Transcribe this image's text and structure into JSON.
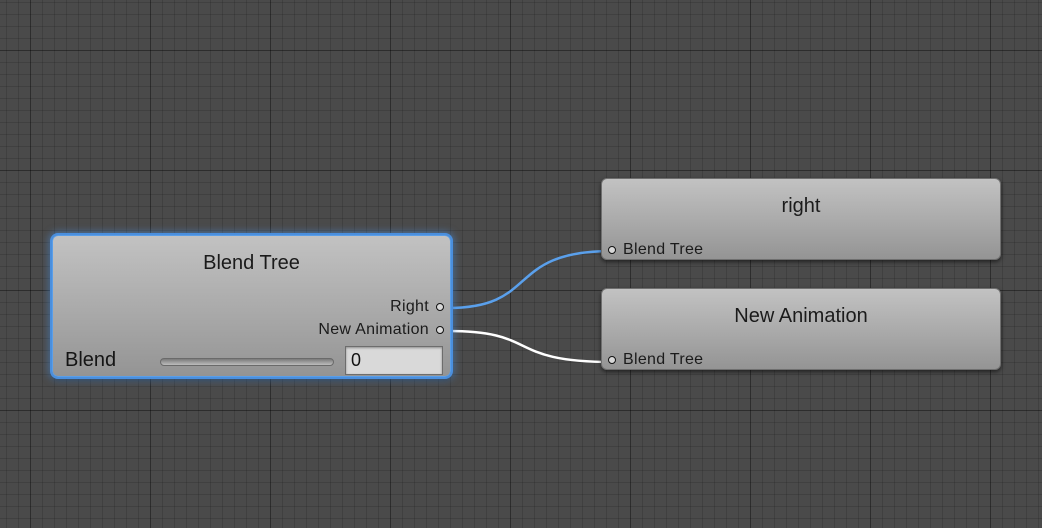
{
  "nodes": {
    "blend_tree": {
      "title": "Blend Tree",
      "outputs": [
        "Right",
        "New Animation"
      ],
      "parameter": {
        "label": "Blend",
        "value": "0"
      }
    },
    "right": {
      "title": "right",
      "input": "Blend Tree"
    },
    "new_animation": {
      "title": "New Animation",
      "input": "Blend Tree"
    }
  },
  "colors": {
    "canvas": "#4a4a4a",
    "selection": "#4a8fde",
    "link_selected": "#5aa0ec",
    "link_default": "#ffffff"
  }
}
